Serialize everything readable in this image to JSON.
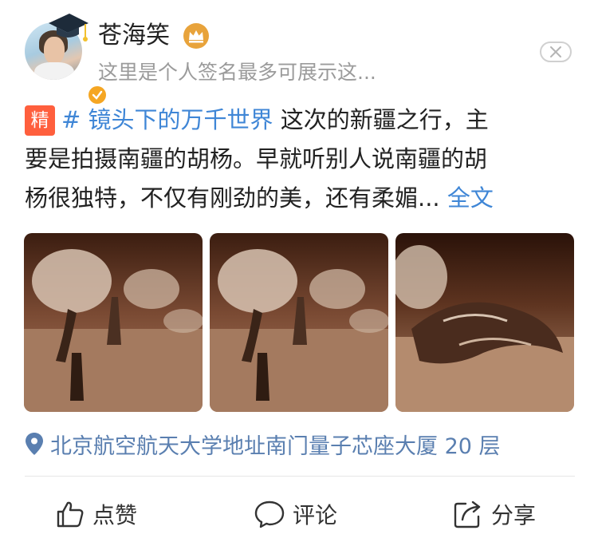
{
  "user": {
    "name": "苍海笑",
    "signature": "这里是个人签名最多可展示这..."
  },
  "post": {
    "tag": "精",
    "topic": "# 镜头下的万千世界",
    "line1": "这次的新疆之行，主",
    "line2": "要是拍摄南疆的胡杨。早就听别人说南疆的胡",
    "line3": "杨很独特，不仅有刚劲的美，还有柔媚... ",
    "more_label": "全文"
  },
  "location": {
    "text": "北京航空航天大学地址南门量子芯座大厦 20 层"
  },
  "actions": {
    "like": "点赞",
    "comment": "评论",
    "share": "分享"
  },
  "colors": {
    "link": "#3f86d6",
    "location": "#5a7fb0",
    "tag": "#ff5f3d",
    "crown": "#e8a33b"
  },
  "icons": [
    "graduation-cap-icon",
    "verified-icon",
    "crown-icon",
    "close-icon",
    "location-pin-icon",
    "thumbs-up-icon",
    "comment-icon",
    "share-icon"
  ]
}
